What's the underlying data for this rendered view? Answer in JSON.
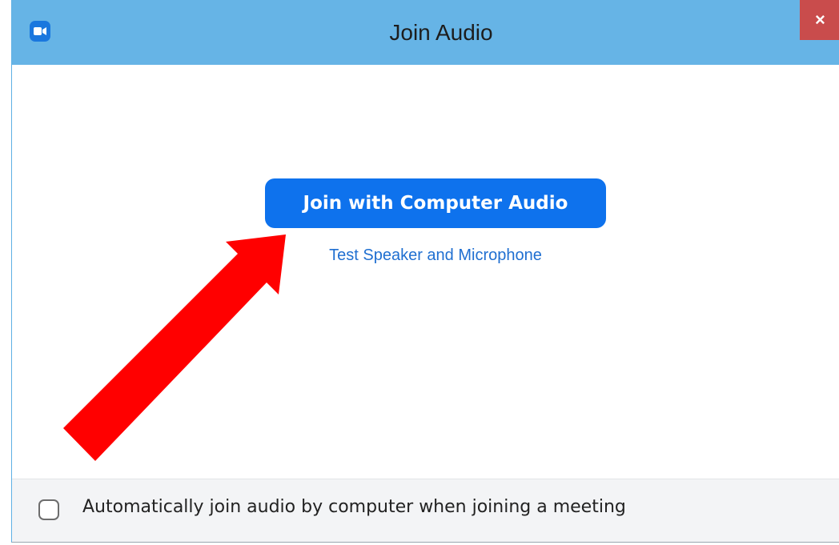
{
  "window": {
    "title": "Join Audio",
    "close_label": "×",
    "app_icon": "zoom-camera-icon"
  },
  "main": {
    "join_button_label": "Join with Computer Audio",
    "test_link_label": "Test Speaker and Microphone"
  },
  "footer": {
    "auto_join_label": "Automatically join audio by computer when joining a meeting",
    "auto_join_checked": false
  },
  "annotation": {
    "arrow_color": "#ff0000"
  },
  "colors": {
    "titlebar": "#66b4e6",
    "primary_button": "#0e72ed",
    "link": "#1f6fd1",
    "close_button": "#c94c4c"
  }
}
